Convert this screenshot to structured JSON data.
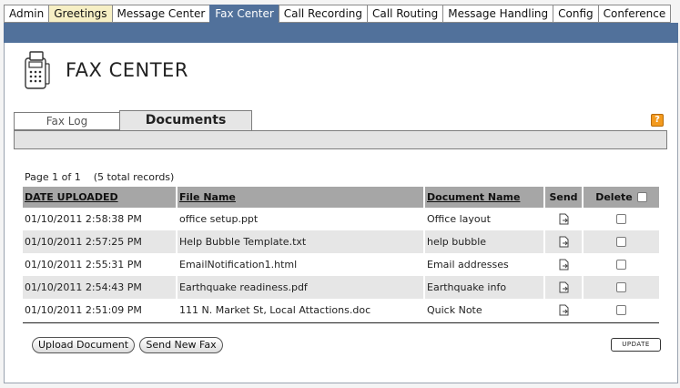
{
  "nav": {
    "tabs": [
      {
        "label": "Admin"
      },
      {
        "label": "Greetings"
      },
      {
        "label": "Message Center"
      },
      {
        "label": "Fax Center"
      },
      {
        "label": "Call Recording"
      },
      {
        "label": "Call Routing"
      },
      {
        "label": "Message Handling"
      },
      {
        "label": "Config"
      },
      {
        "label": "Conference"
      }
    ],
    "active": "Fax Center"
  },
  "page": {
    "title": "FAX CENTER",
    "icon": "fax-device-icon"
  },
  "subtabs": {
    "items": [
      {
        "label": "Fax Log"
      },
      {
        "label": "Documents"
      }
    ],
    "active": "Documents"
  },
  "help": {
    "icon": "help-icon",
    "label": "?"
  },
  "pagination": {
    "page_text": "Page 1 of 1",
    "records_text": "(5 total records)"
  },
  "table": {
    "headers": {
      "date": "DATE UPLOADED",
      "file": "File Name",
      "doc": "Document Name",
      "send": "Send",
      "delete": "Delete"
    },
    "rows": [
      {
        "date": "01/10/2011 2:58:38 PM",
        "file": "office setup.ppt",
        "doc": "Office layout"
      },
      {
        "date": "01/10/2011 2:57:25 PM",
        "file": "Help Bubble Template.txt",
        "doc": "help bubble"
      },
      {
        "date": "01/10/2011 2:55:31 PM",
        "file": "EmailNotification1.html",
        "doc": "Email addresses"
      },
      {
        "date": "01/10/2011 2:54:43 PM",
        "file": "Earthquake readiness.pdf",
        "doc": "Earthquake info"
      },
      {
        "date": "01/10/2011 2:51:09 PM",
        "file": "111 N. Market St, Local Attactions.doc",
        "doc": "Quick Note"
      }
    ]
  },
  "actions": {
    "upload": "Upload Document",
    "send_new_fax": "Send New Fax",
    "update": "UPDATE"
  },
  "colors": {
    "accent": "#51719b",
    "header_row": "#a6a6a6",
    "alt_row": "#e6e6e6",
    "yellow_tab": "#f6efc4",
    "help_orange": "#f39a1e"
  }
}
